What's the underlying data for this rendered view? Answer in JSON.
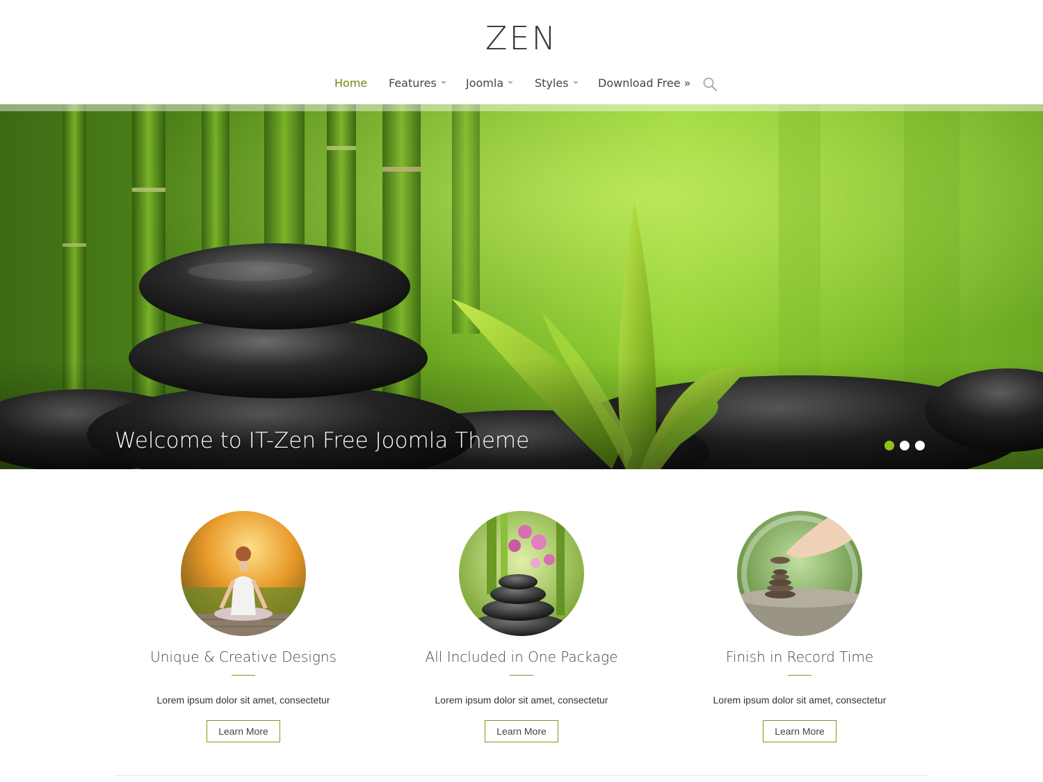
{
  "site": {
    "logo": "ZEN",
    "accent_color": "#6b8a12",
    "dot_active_color": "#8dc21f"
  },
  "nav": {
    "items": [
      {
        "label": "Home",
        "active": true,
        "dropdown": false
      },
      {
        "label": "Features",
        "active": false,
        "dropdown": true
      },
      {
        "label": "Joomla",
        "active": false,
        "dropdown": true
      },
      {
        "label": "Styles",
        "active": false,
        "dropdown": true
      },
      {
        "label": "Download Free »",
        "active": false,
        "dropdown": false
      }
    ],
    "search_icon": "search-icon"
  },
  "hero": {
    "caption": "Welcome to IT-Zen Free Joomla Theme",
    "slide_count": 3,
    "active_slide": 1
  },
  "features": [
    {
      "title": "Unique & Creative Designs",
      "text": "Lorem ipsum dolor sit amet, consectetur",
      "button": "Learn More",
      "image": "meditation-photo"
    },
    {
      "title": "All Included in One Package",
      "text": "Lorem ipsum dolor sit amet, consectetur",
      "button": "Learn More",
      "image": "orchid-stones-photo"
    },
    {
      "title": "Finish in Record Time",
      "text": "Lorem ipsum dolor sit amet, consectetur",
      "button": "Learn More",
      "image": "stacking-stones-photo"
    }
  ]
}
